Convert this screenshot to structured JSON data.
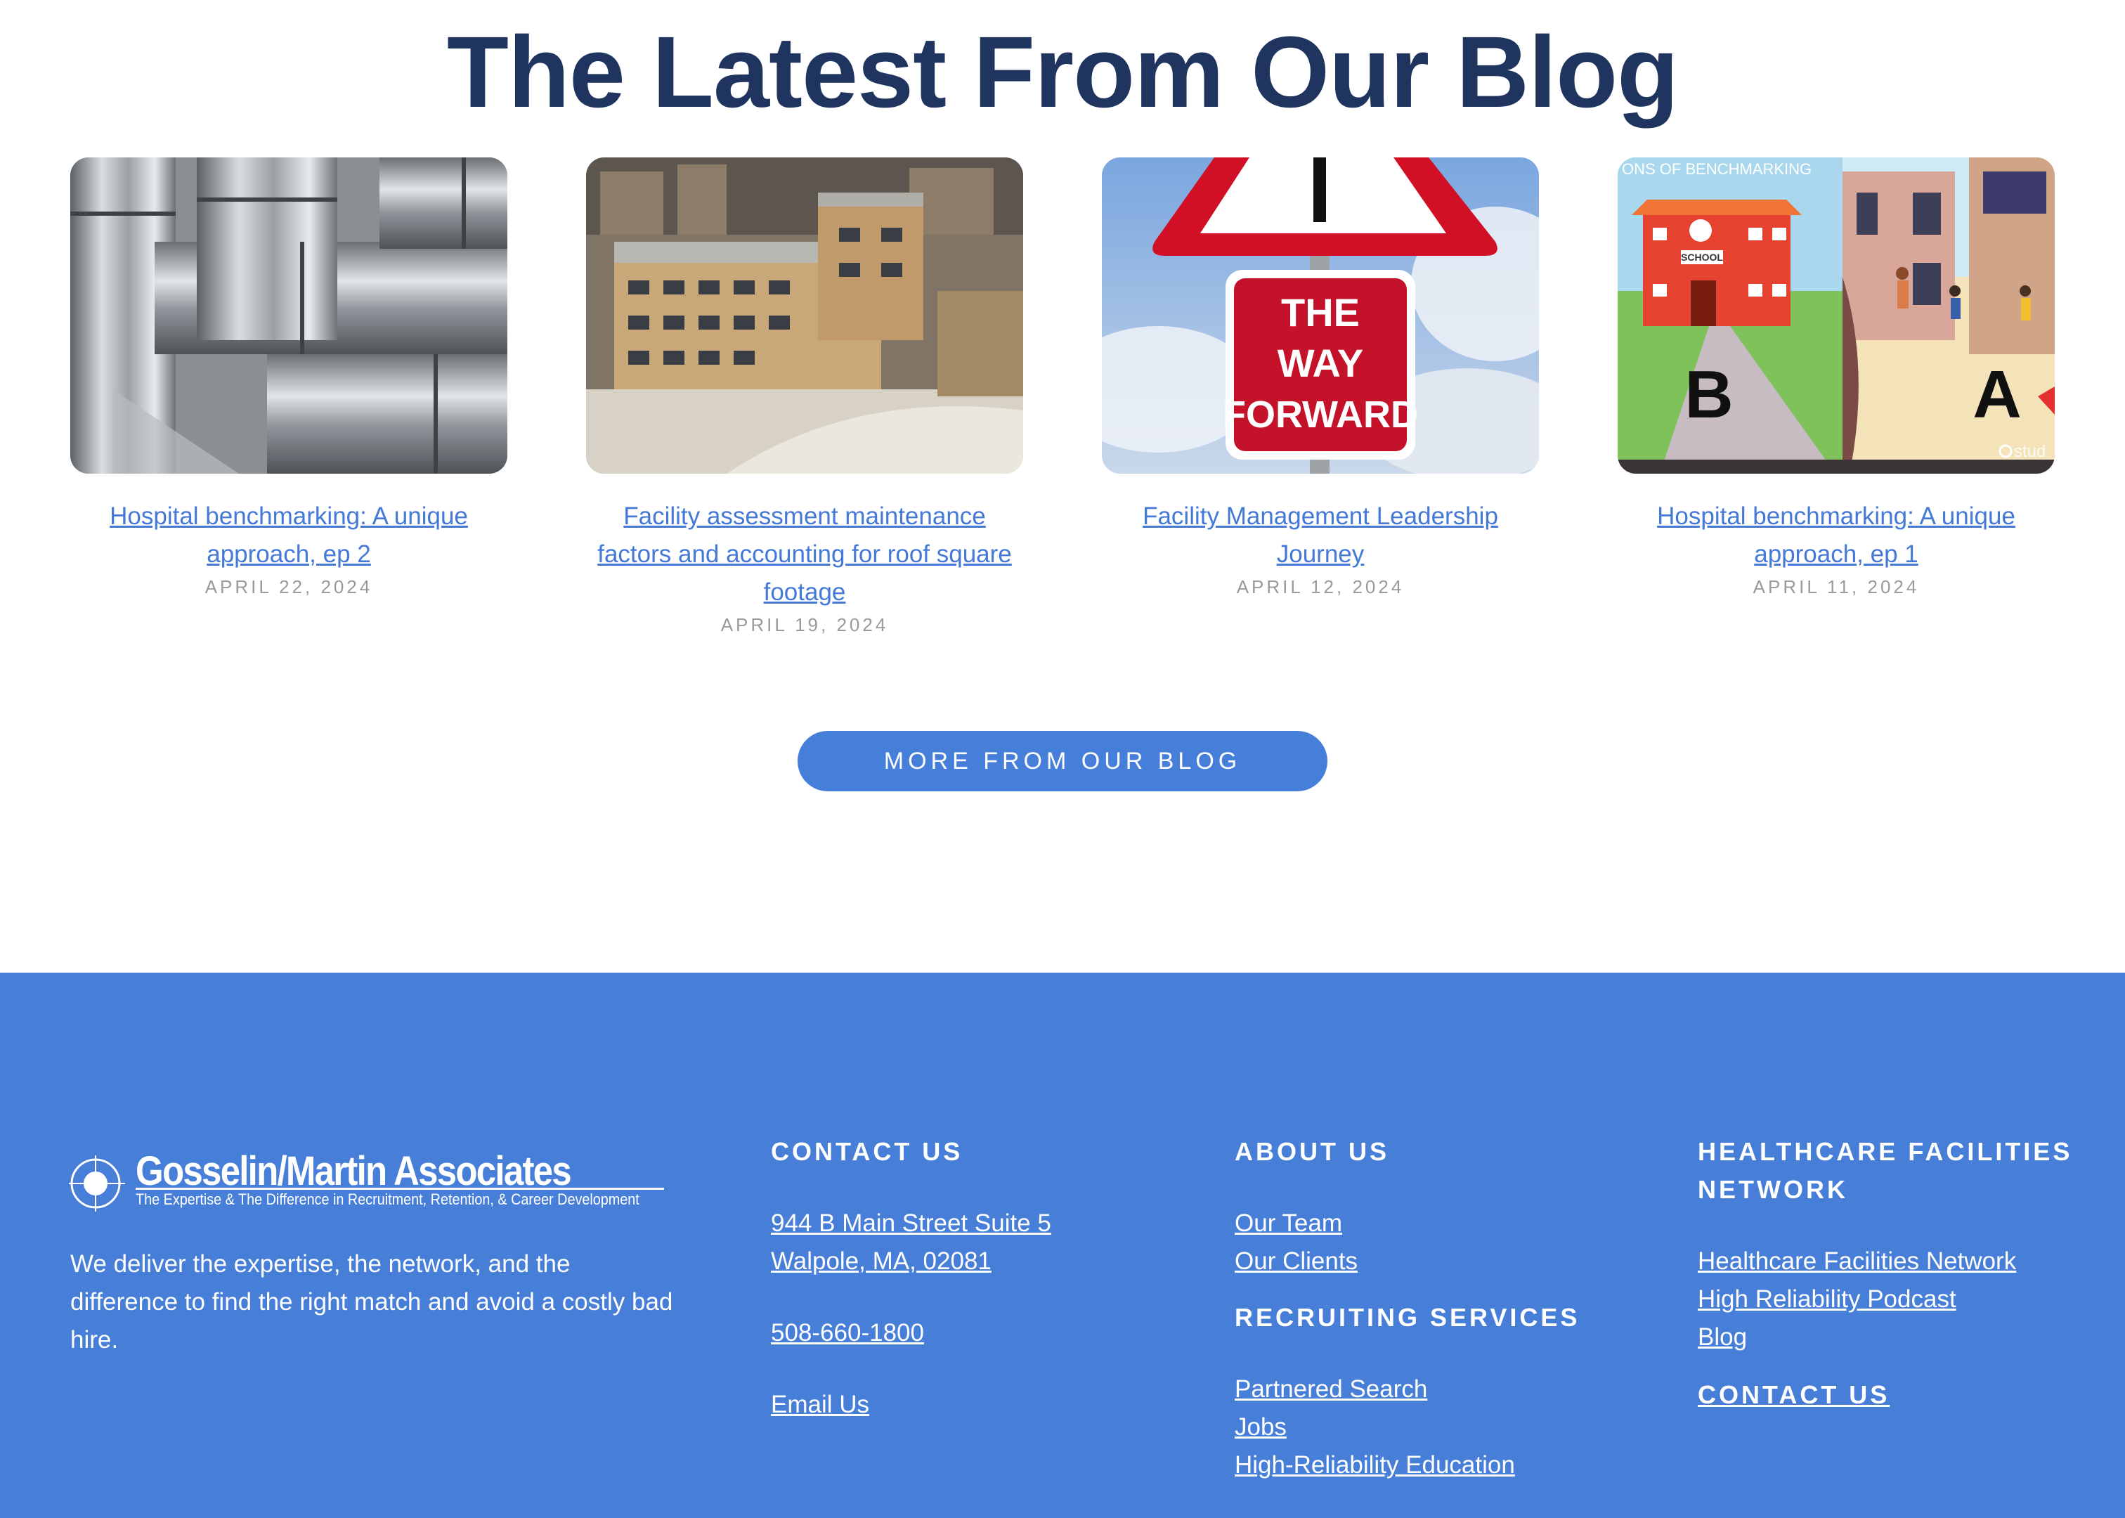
{
  "section_title": "The Latest From Our Blog",
  "posts": [
    {
      "title": "Hospital benchmarking: A unique approach, ep 2",
      "date": "APRIL 22, 2024",
      "image": "ductwork-photo"
    },
    {
      "title": "Facility assessment maintenance factors and accounting for roof square footage",
      "date": "APRIL 19, 2024",
      "image": "hospital-building-photo"
    },
    {
      "title": "Facility Management Leadership Journey",
      "date": "APRIL 12, 2024",
      "image": "way-forward-sign-photo"
    },
    {
      "title": "Hospital benchmarking: A unique approach, ep 1",
      "date": "APRIL 11, 2024",
      "image": "benchmarking-illustration"
    }
  ],
  "thumb_text": {
    "sign": [
      "THE",
      "WAY",
      "FORWARD"
    ],
    "illustration_banner": "ONS OF BENCHMARKING",
    "school": "SCHOOL",
    "label_b": "B",
    "label_a": "A",
    "watermark": "stud"
  },
  "more_button": "MORE FROM OUR BLOG",
  "footer": {
    "logo_name": "Gosselin/Martin Associates",
    "logo_tagline": "The Expertise & The Difference in Recruitment, Retention, & Career Development",
    "mission": "We deliver the expertise, the network, and the difference to find the right match and avoid a costly bad hire.",
    "contact": {
      "heading": "CONTACT US",
      "address_line1": "944 B Main Street Suite 5",
      "address_line2": "Walpole, MA, 02081",
      "phone": "508-660-1800",
      "email": "Email Us"
    },
    "about": {
      "heading": "ABOUT US",
      "links": [
        "Our Team",
        "Our Clients"
      ],
      "recruiting_heading": "RECRUITING SERVICES",
      "recruiting_links": [
        "Partnered Search",
        "Jobs",
        "High-Reliability Education"
      ]
    },
    "network": {
      "heading": "HEALTHCARE FACILITIES NETWORK",
      "links": [
        "Healthcare Facilities Network",
        "High Reliability Podcast",
        "Blog"
      ],
      "contact_link": "CONTACT US"
    }
  },
  "colors": {
    "title": "#1f3560",
    "accent": "#467ed8",
    "link": "#4479d8",
    "date": "#9a9a9a"
  }
}
